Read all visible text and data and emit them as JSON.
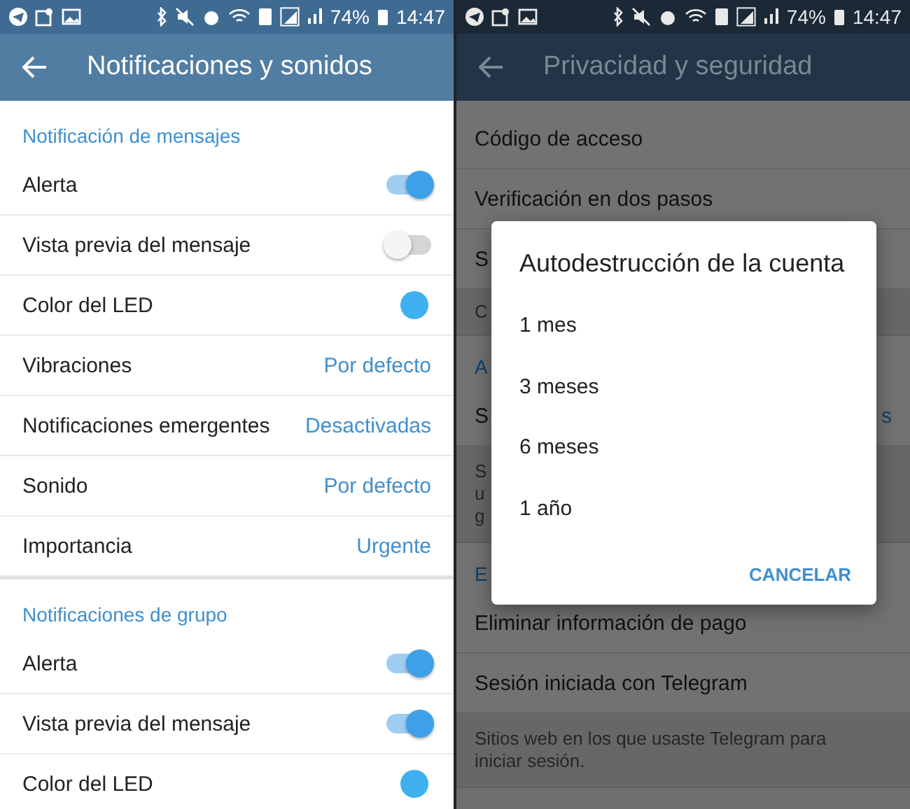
{
  "left_screen": {
    "status_bar": {
      "battery": "74%",
      "time": "14:47"
    },
    "title": "Notificaciones y sonidos",
    "sections": [
      {
        "header": "Notificación de mensajes",
        "rows": [
          {
            "kind": "switch",
            "label": "Alerta",
            "on": true
          },
          {
            "kind": "switch",
            "label": "Vista previa del mensaje",
            "on": false
          },
          {
            "kind": "color",
            "label": "Color del LED",
            "color": "#3fb0f0"
          },
          {
            "kind": "value",
            "label": "Vibraciones",
            "value": "Por defecto"
          },
          {
            "kind": "value",
            "label": "Notificaciones emergentes",
            "value": "Desactivadas"
          },
          {
            "kind": "value",
            "label": "Sonido",
            "value": "Por defecto"
          },
          {
            "kind": "value",
            "label": "Importancia",
            "value": "Urgente"
          }
        ]
      },
      {
        "header": "Notificaciones de grupo",
        "rows": [
          {
            "kind": "switch",
            "label": "Alerta",
            "on": true
          },
          {
            "kind": "switch",
            "label": "Vista previa del mensaje",
            "on": true
          },
          {
            "kind": "color",
            "label": "Color del LED",
            "color": "#3fb0f0"
          }
        ]
      }
    ]
  },
  "right_screen": {
    "status_bar": {
      "battery": "74%",
      "time": "14:47"
    },
    "title": "Privacidad y seguridad",
    "items": [
      {
        "kind": "row",
        "text": "Código de acceso"
      },
      {
        "kind": "row",
        "text": "Verificación en dos pasos"
      },
      {
        "kind": "row",
        "text": "S"
      },
      {
        "kind": "note",
        "lines": [
          "C"
        ]
      },
      {
        "kind": "header",
        "text": "A"
      },
      {
        "kind": "row",
        "text": "S",
        "value": "s"
      },
      {
        "kind": "note",
        "lines": [
          "S",
          "u",
          "g"
        ]
      },
      {
        "kind": "header",
        "text": "E"
      },
      {
        "kind": "row",
        "text": "Eliminar información de pago"
      },
      {
        "kind": "row",
        "text": "Sesión iniciada con Telegram"
      },
      {
        "kind": "note",
        "lines": [
          "Sitios web en los que usaste Telegram para",
          "iniciar sesión."
        ]
      }
    ],
    "dialog": {
      "title": "Autodestrucción de la cuenta",
      "options": [
        "1 mes",
        "3 meses",
        "6 meses",
        "1 año"
      ],
      "button": "CANCELAR"
    }
  }
}
